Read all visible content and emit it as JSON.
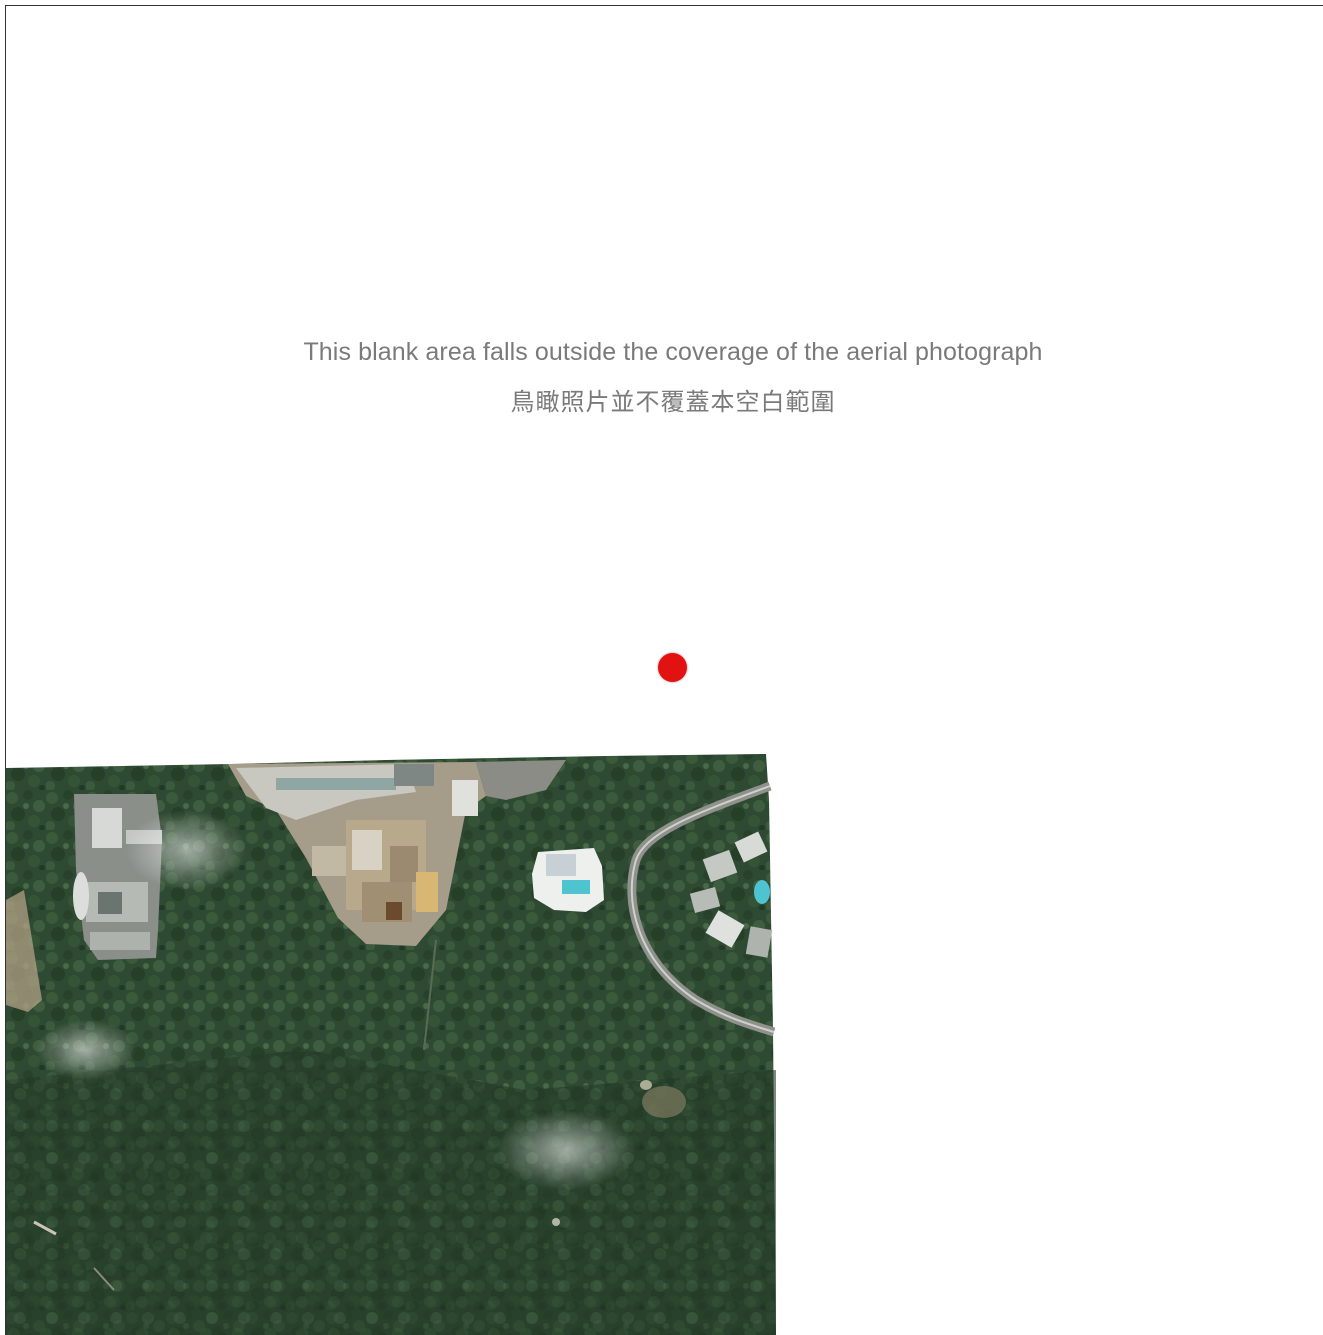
{
  "notice": {
    "english": "This blank area falls outside the coverage of the aerial photograph",
    "chinese": "鳥瞰照片並不覆蓋本空白範圍"
  },
  "marker": {
    "color": "#e21212",
    "icon": "location-dot-icon"
  },
  "aerial_photo": {
    "dominant_color": "#2f4a32",
    "features": [
      "forested-hillside",
      "construction-site",
      "buildings",
      "swimming-pool",
      "curved-road"
    ]
  }
}
